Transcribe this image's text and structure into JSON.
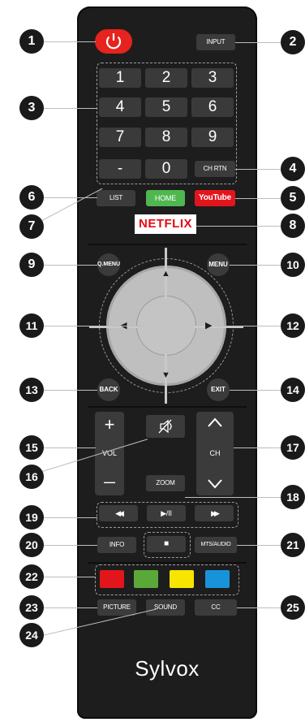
{
  "remote": {
    "input_label": "INPUT",
    "numbers": [
      "1",
      "2",
      "3",
      "4",
      "5",
      "6",
      "7",
      "8",
      "9",
      "-",
      "0"
    ],
    "chrtn_label": "CH RTN",
    "list_label": "LIST",
    "home_label": "HOME",
    "youtube_label": "YouTube",
    "netflix_label": "NETFLIX",
    "qmenu_label": "Q.MENU",
    "menu_label": "MENU",
    "back_label": "BACK",
    "exit_label": "EXIT",
    "vol_label": "VOL",
    "vol_plus": "+",
    "vol_minus": "—",
    "ch_label": "CH",
    "zoom_label": "ZOOM",
    "rewind_glyph": "◀◀",
    "playpause_glyph": "▶/II",
    "ff_glyph": "▶▶",
    "info_label": "INFO",
    "stop_glyph": "■",
    "mts_label": "MTS/AUDIO",
    "picture_label": "PICTURE",
    "sound_label": "SOUND",
    "cc_label": "CC",
    "brand": "Sylvox",
    "colors": {
      "red": "#e3151c",
      "green": "#5aa83a",
      "yellow": "#f7e500",
      "blue": "#1893d9",
      "power": "#e5231f",
      "home": "#4fb74f",
      "netflix": "#e50914"
    }
  },
  "callouts": [
    "1",
    "2",
    "3",
    "4",
    "5",
    "6",
    "7",
    "8",
    "9",
    "10",
    "11",
    "12",
    "13",
    "14",
    "15",
    "16",
    "17",
    "18",
    "19",
    "20",
    "21",
    "22",
    "23",
    "24",
    "25"
  ]
}
